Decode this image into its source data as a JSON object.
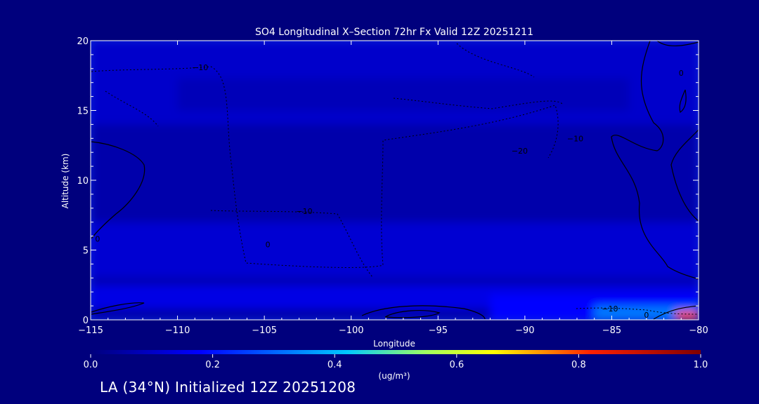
{
  "chart_data": {
    "type": "heatmap",
    "title": "SO4 Longitudinal X–Section 72hr  Fx Valid 12Z 20251211",
    "xlabel": "Longitude",
    "ylabel": "Altitude (km)",
    "xlim": [
      -115,
      -80
    ],
    "ylim": [
      0,
      20
    ],
    "x_ticks": [
      -115,
      -110,
      -105,
      -100,
      -95,
      -90,
      -85,
      -80
    ],
    "x_tick_labels": [
      "−115",
      "−110",
      "−105",
      "−100",
      "−95",
      "−90",
      "−85",
      "−80"
    ],
    "y_ticks": [
      0,
      5,
      10,
      15,
      20
    ],
    "y_tick_labels": [
      "0",
      "5",
      "10",
      "15",
      "20"
    ],
    "colorbar": {
      "min": 0.0,
      "max": 1.0,
      "ticks": [
        0.0,
        0.2,
        0.4,
        0.6,
        0.8,
        1.0
      ],
      "tick_labels": [
        "0.0",
        "0.2",
        "0.4",
        "0.6",
        "0.8",
        "1.0"
      ],
      "units": "(ug/m³)",
      "colors": [
        "#00007d",
        "#0000ff",
        "#00c8ff",
        "#ffff00",
        "#ff0000",
        "#800000"
      ]
    },
    "contour_labels": [
      {
        "text": "−10",
        "lon": -108.7,
        "alt": 17.9
      },
      {
        "text": "−10",
        "lon": -87.1,
        "alt": 12.8
      },
      {
        "text": "−20",
        "lon": -90.3,
        "alt": 11.9
      },
      {
        "text": "−10",
        "lon": -102.7,
        "alt": 7.6
      },
      {
        "text": "0",
        "lon": -104.8,
        "alt": 5.2
      },
      {
        "text": "−10",
        "lon": -85.1,
        "alt": 0.6
      },
      {
        "text": "0",
        "lon": -83.0,
        "alt": 0.15
      },
      {
        "text": "0",
        "lon": -81.0,
        "alt": 17.5
      },
      {
        "text": "0",
        "lon": -114.6,
        "alt": 5.6
      }
    ],
    "regions": [
      {
        "lon": [
          -115,
          -80
        ],
        "alt": [
          0,
          20
        ],
        "value": 0.07
      },
      {
        "lon": [
          -115,
          -80
        ],
        "alt": [
          14,
          20
        ],
        "value": 0.12
      },
      {
        "lon": [
          -110,
          -84
        ],
        "alt": [
          15,
          17.3
        ],
        "value": 0.09
      },
      {
        "lon": [
          -115,
          -80
        ],
        "alt": [
          3,
          7
        ],
        "value": 0.13
      },
      {
        "lon": [
          -115,
          -80
        ],
        "alt": [
          0.8,
          2.5
        ],
        "value": 0.16
      },
      {
        "lon": [
          -92,
          -80
        ],
        "alt": [
          0,
          1.8
        ],
        "value": 0.2
      },
      {
        "lon": [
          -86,
          -80
        ],
        "alt": [
          0,
          1.0
        ],
        "value": 0.32
      },
      {
        "lon": [
          -81.3,
          -80
        ],
        "alt": [
          0,
          0.6
        ],
        "value": 0.75
      }
    ]
  },
  "footer": {
    "label": "LA (34°N) Initialized 12Z 20251208"
  }
}
